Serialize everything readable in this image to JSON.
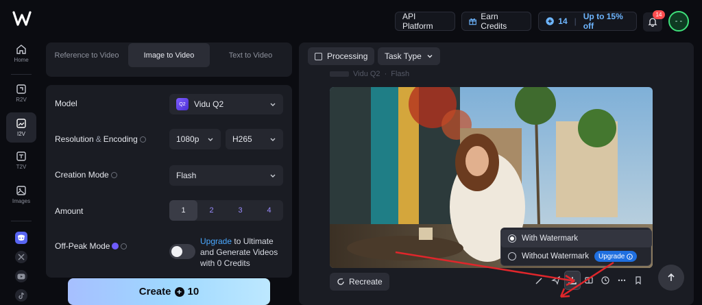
{
  "nav": {
    "items": [
      {
        "label": "Home",
        "icon": "home-icon"
      },
      {
        "label": "R2V",
        "icon": "r2v-icon"
      },
      {
        "label": "I2V",
        "icon": "i2v-icon",
        "active": true
      },
      {
        "label": "T2V",
        "icon": "t2v-icon"
      },
      {
        "label": "Images",
        "icon": "images-icon"
      }
    ],
    "social": [
      "discord-icon",
      "x-icon",
      "youtube-icon",
      "tiktok-icon"
    ]
  },
  "topbar": {
    "api_platform": "API Platform",
    "earn_credits": "Earn Credits",
    "credits_count": "14",
    "credits_offer": "Up to 15% off",
    "notification_count": "14",
    "avatar_text": "- -"
  },
  "tabs": {
    "reference": "Reference to Video",
    "image": "Image to Video",
    "text": "Text to Video",
    "active": "Image to Video"
  },
  "form": {
    "model_label": "Model",
    "model_value": "Vidu Q2",
    "model_icon_text": "Q2",
    "resolution_label_a": "Resolution",
    "resolution_label_amp": "&",
    "resolution_label_b": "Encoding",
    "resolution_value": "1080p",
    "encoding_value": "H265",
    "creation_label": "Creation Mode",
    "creation_value": "Flash",
    "amount_label": "Amount",
    "amounts": [
      "1",
      "2",
      "3",
      "4"
    ],
    "amount_selected": "1",
    "offpeak_label": "Off-Peak Mode",
    "offpeak_link": "Upgrade",
    "offpeak_text": " to Ultimate and Generate Videos with 0 Credits",
    "offpeak_enabled": false
  },
  "create": {
    "label": "Create",
    "cost": "10"
  },
  "result": {
    "processing_label": "Processing",
    "task_type_label": "Task Type",
    "ghost_model": "Vidu Q2",
    "ghost_sep": "·",
    "ghost_mode": "Flash",
    "watermark_options": [
      "With Watermark",
      "Without Watermark"
    ],
    "watermark_selected": "With Watermark",
    "upgrade_tag": "Upgrade",
    "recreate_label": "Recreate",
    "actions": [
      "edit-icon",
      "send-icon",
      "download-icon",
      "compare-icon",
      "history-icon",
      "more-icon",
      "bookmark-icon"
    ]
  },
  "colors": {
    "accent_blue": "#4aa8ff",
    "annotation_red": "#e0262b",
    "create_gradient": [
      "#a6bfff",
      "#bde8ff"
    ]
  }
}
